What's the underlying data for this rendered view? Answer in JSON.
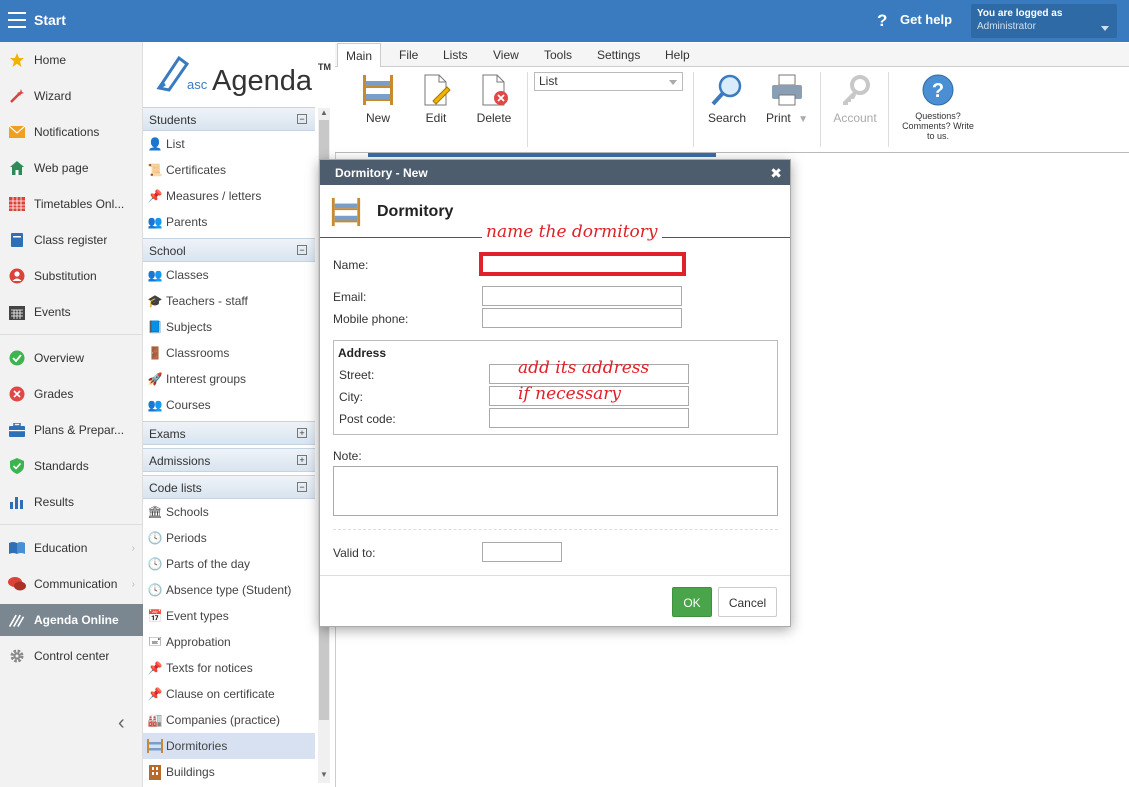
{
  "topbar": {
    "title": "Start",
    "help_label": "Get help",
    "help_icon": "?",
    "login_label": "You are logged as",
    "login_user": "Administrator"
  },
  "nav": {
    "items": [
      {
        "label": "Home",
        "icon": "star-icon"
      },
      {
        "label": "Wizard",
        "icon": "wand-icon"
      },
      {
        "label": "Notifications",
        "icon": "envelope-icon"
      },
      {
        "label": "Web page",
        "icon": "house-icon"
      },
      {
        "label": "Timetables Onl...",
        "icon": "grid-icon"
      },
      {
        "label": "Class register",
        "icon": "book-icon"
      },
      {
        "label": "Substitution",
        "icon": "person-icon"
      },
      {
        "label": "Events",
        "icon": "calendar-icon"
      },
      {
        "label": "Overview",
        "icon": "check-circle-icon"
      },
      {
        "label": "Grades",
        "icon": "grades-icon"
      },
      {
        "label": "Plans & Prepar...",
        "icon": "briefcase-icon"
      },
      {
        "label": "Standards",
        "icon": "shield-icon"
      },
      {
        "label": "Results",
        "icon": "bar-chart-icon"
      },
      {
        "label": "Education",
        "icon": "open-book-icon"
      },
      {
        "label": "Communication",
        "icon": "chat-icon"
      },
      {
        "label": "Agenda Online",
        "icon": "agenda-logo-icon"
      },
      {
        "label": "Control center",
        "icon": "gear-icon"
      }
    ]
  },
  "panel": {
    "logo_prefix": "asc",
    "logo_name": "Agenda",
    "logo_tm": "TM",
    "sections": {
      "students": {
        "title": "Students",
        "toggle": "−",
        "items": [
          "List",
          "Certificates",
          "Measures / letters",
          "Parents"
        ]
      },
      "school": {
        "title": "School",
        "toggle": "−",
        "items": [
          "Classes",
          "Teachers - staff",
          "Subjects",
          "Classrooms",
          "Interest groups",
          "Courses"
        ]
      },
      "exams": {
        "title": "Exams",
        "toggle": "+"
      },
      "admissions": {
        "title": "Admissions",
        "toggle": "+"
      },
      "codelists": {
        "title": "Code lists",
        "toggle": "−",
        "items": [
          "Schools",
          "Periods",
          "Parts of the day",
          "Absence type (Student)",
          "Event types",
          "Approbation",
          "Texts for notices",
          "Clause on certificate",
          "Companies (practice)",
          "Dormitories",
          "Buildings"
        ]
      }
    }
  },
  "ribbon": {
    "tabs": [
      "Main",
      "File",
      "Lists",
      "View",
      "Tools",
      "Settings",
      "Help"
    ],
    "buttons": {
      "new": "New",
      "edit": "Edit",
      "delete": "Delete",
      "search": "Search",
      "print": "Print",
      "account": "Account",
      "questions": "Questions? Comments? Write to us."
    },
    "list_select_value": "List"
  },
  "dialog": {
    "title": "Dormitory - New",
    "close": "✖",
    "heading": "Dormitory",
    "fields": {
      "name": "Name:",
      "email": "Email:",
      "mobile": "Mobile phone:",
      "address_title": "Address",
      "street": "Street:",
      "city": "City:",
      "postcode": "Post code:",
      "note": "Note:",
      "valid_to": "Valid to:"
    },
    "ok": "OK",
    "cancel": "Cancel"
  },
  "annotations": {
    "name_hint": "name the dormitory",
    "address_hint_1": "add its address",
    "address_hint_2": "if necessary"
  },
  "colors": {
    "topbar": "#3a7bbf",
    "ok": "#4aa54a",
    "annotation": "#e0202a",
    "dialog_title": "#4d5d6d"
  }
}
